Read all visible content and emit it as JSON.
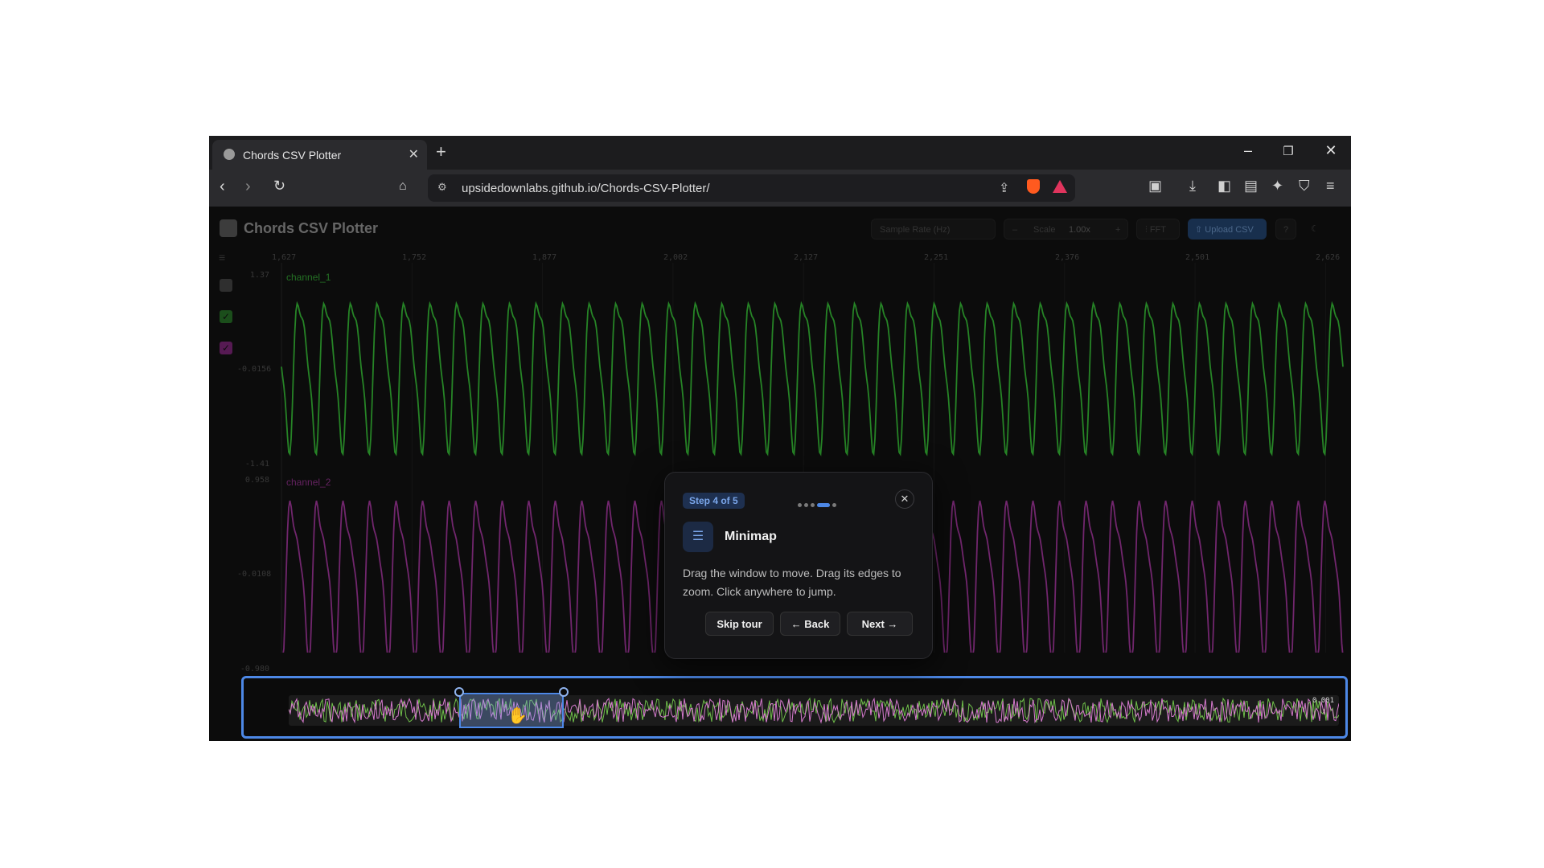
{
  "browser": {
    "tab_title": "Chords CSV Plotter",
    "url": "upsidedownlabs.github.io/Chords-CSV-Plotter/"
  },
  "app": {
    "title": "Chords CSV Plotter",
    "sample_rate_placeholder": "Sample Rate (Hz)",
    "scale_label": "Scale",
    "scale_value": "1.00x",
    "fft_label": "FFT",
    "upload_label": "Upload CSV",
    "help_label": "?",
    "colors": {
      "channel_1": "#2fa12f",
      "channel_2": "#8a2f86",
      "accent": "#4d88e6"
    }
  },
  "plot": {
    "x_ticks": [
      "1,627",
      "1,752",
      "1,877",
      "2,002",
      "2,127",
      "2,251",
      "2,376",
      "2,501",
      "2,626"
    ],
    "channels": [
      {
        "name": "channel_1",
        "y_max": "1.37",
        "y_mid": "-0.0156",
        "y_min": "-1.41"
      },
      {
        "name": "channel_2",
        "y_max": "0.958",
        "y_mid": "-0.0108",
        "y_min": "-0.980"
      }
    ]
  },
  "minimap": {
    "label_right": "0.001"
  },
  "tour": {
    "step": "Step 4 of 5",
    "current_step": 4,
    "total_steps": 5,
    "title": "Minimap",
    "body": "Drag the window to move. Drag its edges to zoom. Click anywhere to jump.",
    "skip_label": "Skip tour",
    "back_label": "← Back",
    "next_label": "Next →"
  }
}
